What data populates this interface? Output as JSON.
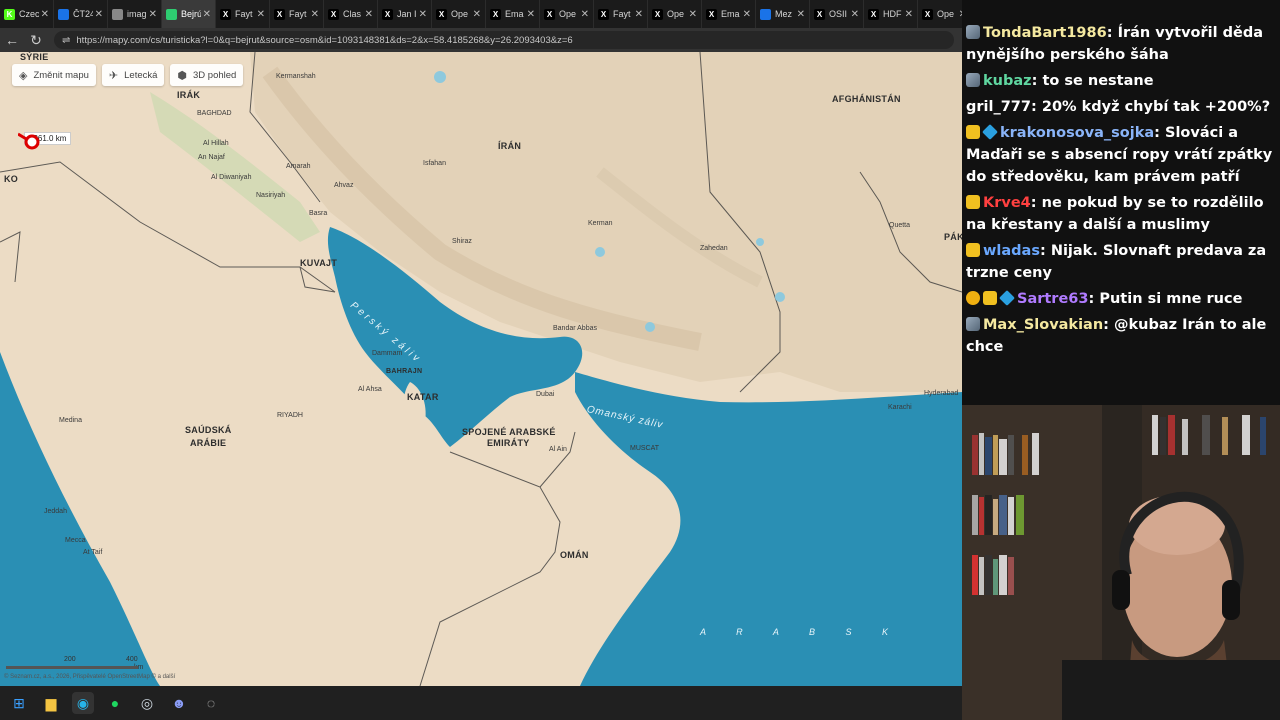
{
  "browser": {
    "tabs": [
      {
        "label": "Czec",
        "icon": "K",
        "color": "#53fc18",
        "active": false
      },
      {
        "label": "ČT24",
        "icon": "",
        "color": "#1a73e8",
        "active": false
      },
      {
        "label": "imag",
        "icon": "",
        "color": "#888888",
        "active": false
      },
      {
        "label": "Bejrú",
        "icon": "",
        "color": "#2ecc71",
        "active": true
      },
      {
        "label": "Fayt",
        "icon": "X",
        "color": "#000000",
        "active": false
      },
      {
        "label": "Fayt",
        "icon": "X",
        "color": "#000000",
        "active": false
      },
      {
        "label": "Clas",
        "icon": "X",
        "color": "#000000",
        "active": false
      },
      {
        "label": "Jan I",
        "icon": "X",
        "color": "#000000",
        "active": false
      },
      {
        "label": "Ope",
        "icon": "X",
        "color": "#000000",
        "active": false
      },
      {
        "label": "Ema",
        "icon": "X",
        "color": "#000000",
        "active": false
      },
      {
        "label": "Ope",
        "icon": "X",
        "color": "#000000",
        "active": false
      },
      {
        "label": "Fayt",
        "icon": "X",
        "color": "#000000",
        "active": false
      },
      {
        "label": "Ope",
        "icon": "X",
        "color": "#000000",
        "active": false
      },
      {
        "label": "Ema",
        "icon": "X",
        "color": "#000000",
        "active": false
      },
      {
        "label": "Mez",
        "icon": "",
        "color": "#1a73e8",
        "active": false
      },
      {
        "label": "OSII",
        "icon": "X",
        "color": "#000000",
        "active": false
      },
      {
        "label": "HDF",
        "icon": "X",
        "color": "#000000",
        "active": false
      },
      {
        "label": "Ope",
        "icon": "X",
        "color": "#000000",
        "active": false
      }
    ],
    "url": "https://mapy.com/cs/turisticka?l=0&q=bejrut&source=osm&id=1093148381&ds=2&x=58.4185268&y=26.2093403&z=6"
  },
  "map": {
    "controls": {
      "change_map": "Změnit mapu",
      "aerial": "Letecká",
      "view3d": "3D pohled"
    },
    "distance_label": "2361.0 km",
    "countries": {
      "syria": "SÝRIE",
      "iraq": "IRÁK",
      "iran": "ÍRÁN",
      "afghanistan": "AFGHÁNISTÁN",
      "kuwait": "KUVAJT",
      "bahrain": "BAHRAJN",
      "qatar": "KATAR",
      "uae_1": "SPOJENÉ ARABSKÉ",
      "uae_2": "EMIRÁTY",
      "saudi_1": "SAÚDSKÁ",
      "saudi_2": "ARÁBIE",
      "oman": "OMÁN",
      "pak": "PÁK",
      "ko": "KO"
    },
    "cities": {
      "baghdad": "BAGHDAD",
      "kermanshah": "Kermanshah",
      "isfahan": "Isfahan",
      "shiraz": "Shiraz",
      "basra": "Basra",
      "ahvaz": "Ahvaz",
      "dammam": "Dammam",
      "riyadh": "RIYADH",
      "medina": "Medina",
      "mecca": "Mecca",
      "jeddah": "Jeddah",
      "dubai": "Dubai",
      "muscat": "MUSCAT",
      "bandar_abbas": "Bandar Abbas",
      "kerman": "Kerman",
      "zahedan": "Zahedan",
      "quetta": "Quetta",
      "karachi": "Karachi",
      "hyderabad": "Hyderabad",
      "al_ahsa": "Al Ahsa",
      "al_ain": "Al Ain",
      "an_najaf": "An Najaf",
      "al_hillah": "Al Hillah",
      "amarah": "Amarah",
      "nasiriyah": "Nasiriyah",
      "taif": "At Taif",
      "al_diwaniyah": "Al Diwaniyah"
    },
    "seas": {
      "persian_gulf": "Perský záliv",
      "gulf_of_oman": "Omanský záliv",
      "arabian": "A R A B S K"
    },
    "scale": {
      "s1": "200",
      "s2": "400",
      "unit": "km"
    },
    "copyright": "© Seznam.cz, a.s., 2026, Přispěvatelé OpenStreetMap © a další"
  },
  "taskbar": {
    "items": [
      "windows-start",
      "file-explorer",
      "edge",
      "spotify",
      "steam",
      "discord",
      "obs"
    ]
  },
  "chat": {
    "messages": [
      {
        "badges": [
          "sword"
        ],
        "user": "TondaBart1986",
        "color": "#f5e9a0",
        "text": "Írán vytvořil děda nynějšího perského šáha"
      },
      {
        "badges": [
          "sword"
        ],
        "user": "kubaz",
        "color": "#5fd6a0",
        "text": "to se nestane"
      },
      {
        "badges": [],
        "user": "gril_777",
        "color": "#ffffff",
        "text": "20% když chybí tak +200%?"
      },
      {
        "badges": [
          "gold",
          "gem"
        ],
        "user": "krakonosova_sojka",
        "color": "#8ab4f8",
        "text": "Slováci a Maďaři se s absencí ropy vrátí zpátky do středověku, kam právem patří"
      },
      {
        "badges": [
          "gold"
        ],
        "user": "Krve4",
        "color": "#ff4040",
        "text": "ne pokud by se to rozdělilo na křestany a další a muslimy"
      },
      {
        "badges": [
          "gold"
        ],
        "user": "wladas",
        "color": "#6aa8ff",
        "text": "Nijak. Slovnaft predava za trzne ceny"
      },
      {
        "badges": [
          "coin",
          "gold",
          "gem"
        ],
        "user": "Sartre63",
        "color": "#b07bff",
        "text": "Putin si mne ruce"
      },
      {
        "badges": [
          "sword"
        ],
        "user": "Max_Slovakian",
        "color": "#f5e9a0",
        "text": "@kubaz Irán to ale chce"
      }
    ]
  },
  "colors": {
    "sea": "#2a8fb4",
    "land": "#ecdcc5",
    "accent": "#53fc18"
  }
}
